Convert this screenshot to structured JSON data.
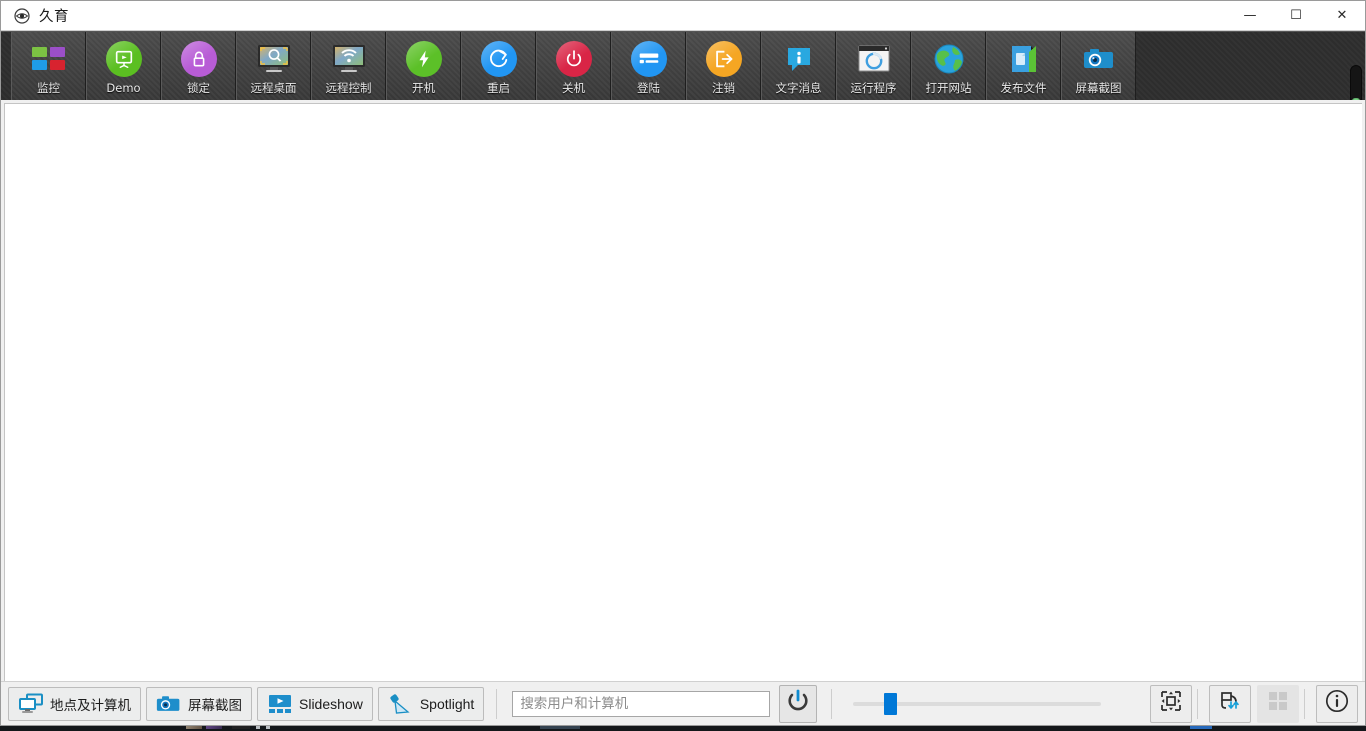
{
  "window": {
    "title": "久育",
    "app_icon": "eye-icon",
    "controls": {
      "minimize": "—",
      "maximize": "☐",
      "close": "✕"
    }
  },
  "toolbar": {
    "items": [
      {
        "label": "监控",
        "icon": "grid-tiles-icon",
        "color": "#7cc243"
      },
      {
        "label": "Demo",
        "icon": "presentation-icon",
        "color": "#5bbf21"
      },
      {
        "label": "锁定",
        "icon": "lock-icon",
        "color": "#b85cd6"
      },
      {
        "label": "远程桌面",
        "icon": "monitor-search-icon",
        "color": "#9bb7c4"
      },
      {
        "label": "远程控制",
        "icon": "monitor-wifi-icon",
        "color": "#9bb7c4"
      },
      {
        "label": "开机",
        "icon": "power-bolt-icon",
        "color": "#5cc028"
      },
      {
        "label": "重启",
        "icon": "restart-icon",
        "color": "#2196f3"
      },
      {
        "label": "关机",
        "icon": "shutdown-icon",
        "color": "#d92546"
      },
      {
        "label": "登陆",
        "icon": "login-card-icon",
        "color": "#2196f3"
      },
      {
        "label": "注销",
        "icon": "logout-arrow-icon",
        "color": "#f5a623"
      },
      {
        "label": "文字消息",
        "icon": "message-info-icon",
        "color": "#29a8e0"
      },
      {
        "label": "运行程序",
        "icon": "run-program-icon",
        "color": "#f2f2f2"
      },
      {
        "label": "打开网站",
        "icon": "globe-icon",
        "color": "#2aa3dd"
      },
      {
        "label": "发布文件",
        "icon": "publish-file-icon",
        "color": "#3aa0e0"
      },
      {
        "label": "屏幕截图",
        "icon": "screen-capture-icon",
        "color": "#2196d4"
      }
    ],
    "scrollbar": {
      "name": "toolbar-vertical-scrollbar",
      "thumb_color": "#3f9e52"
    }
  },
  "bottom_bar": {
    "mode_buttons": [
      {
        "label": "地点及计算机",
        "icon": "computers-icon",
        "lang": "zh"
      },
      {
        "label": "屏幕截图",
        "icon": "screen-capture-icon",
        "lang": "zh"
      },
      {
        "label": "Slideshow",
        "icon": "slideshow-icon",
        "lang": "en"
      },
      {
        "label": "Spotlight",
        "icon": "spotlight-icon",
        "lang": "en"
      }
    ],
    "search": {
      "placeholder": "搜索用户和计算机",
      "value": ""
    },
    "power_button": {
      "name": "power-toggle-button",
      "icon": "power-icon",
      "accent": "#0f8bd0"
    },
    "zoom_slider": {
      "name": "thumbnail-size-slider",
      "value_percent": 13,
      "accent": "#0078d7"
    },
    "right_tools": [
      {
        "name": "fit-to-screen-button",
        "icon": "fit-screen-icon",
        "active": false
      },
      {
        "name": "sort-order-button",
        "icon": "sort-arrows-icon",
        "active": false
      },
      {
        "name": "grid-layout-button",
        "icon": "grid-layout-icon",
        "active": true
      },
      {
        "name": "info-button",
        "icon": "info-icon",
        "active": false
      }
    ]
  },
  "content": {
    "empty": ""
  }
}
